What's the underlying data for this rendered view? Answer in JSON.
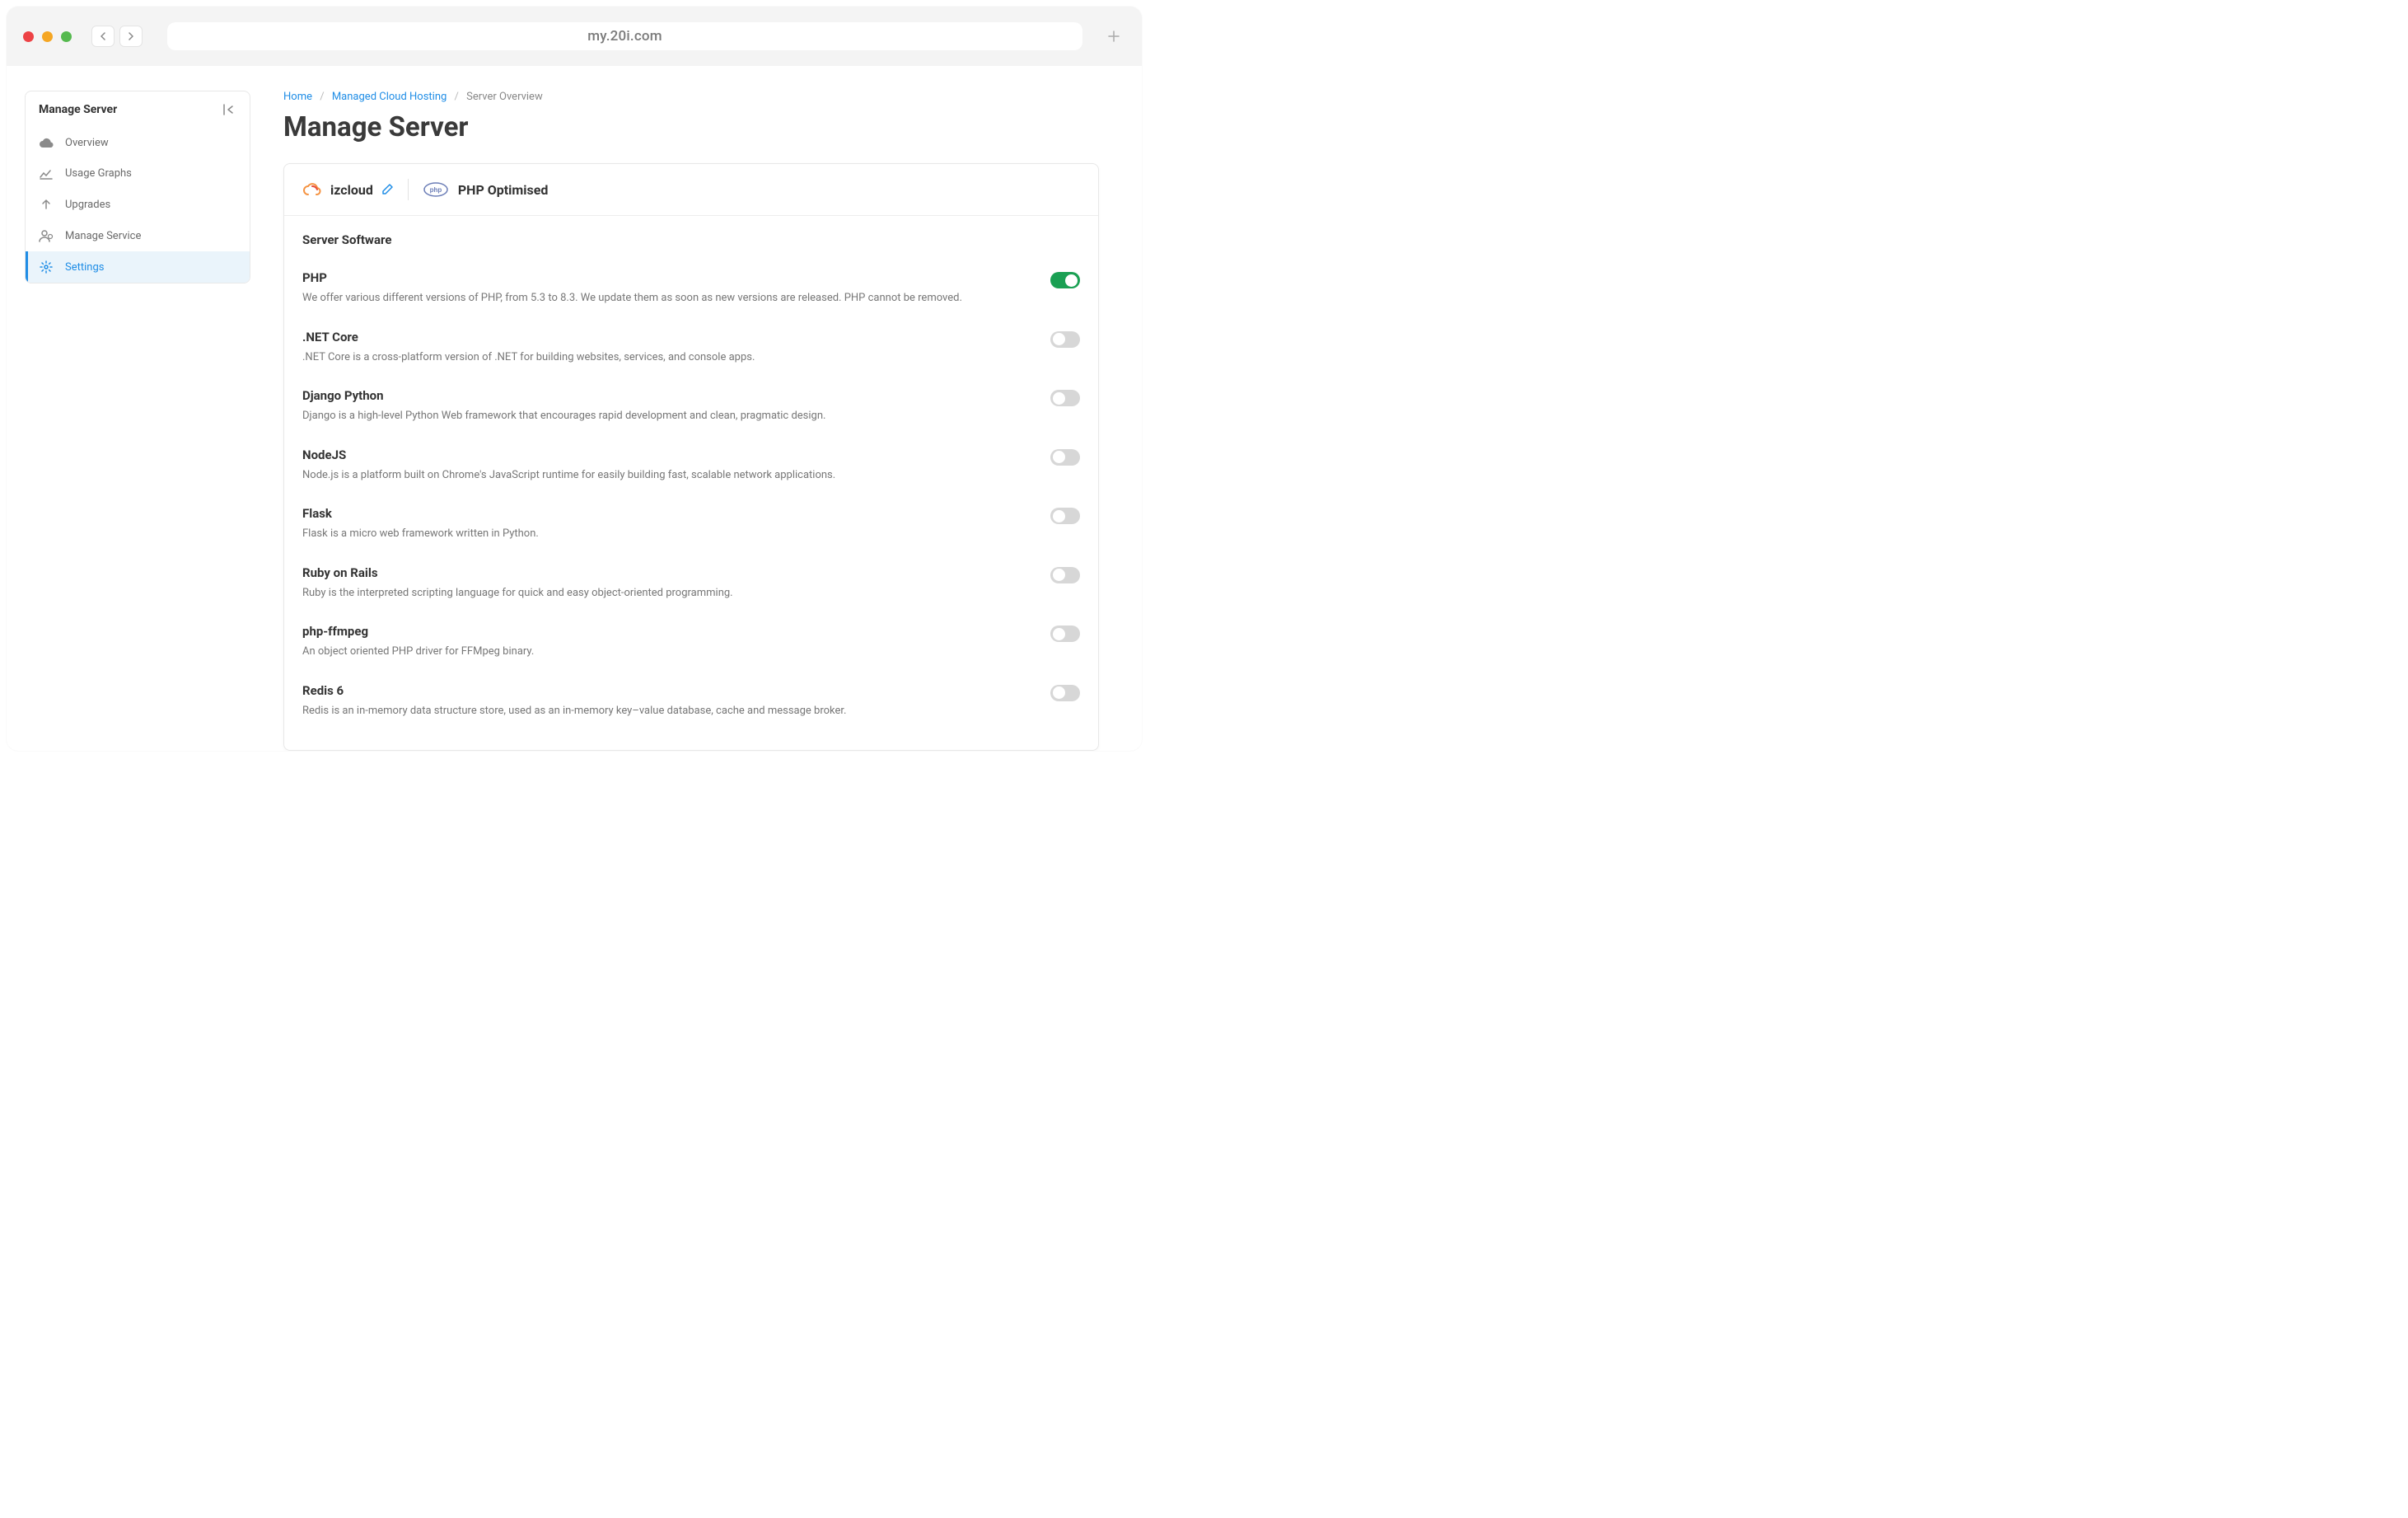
{
  "browser": {
    "url": "my.20i.com"
  },
  "sidebar": {
    "title": "Manage Server",
    "items": [
      {
        "label": "Overview",
        "icon": "cloud"
      },
      {
        "label": "Usage Graphs",
        "icon": "chart"
      },
      {
        "label": "Upgrades",
        "icon": "upload"
      },
      {
        "label": "Manage Service",
        "icon": "user-gear"
      },
      {
        "label": "Settings",
        "icon": "gear",
        "active": true
      }
    ]
  },
  "breadcrumb": {
    "items": [
      {
        "label": "Home",
        "link": true
      },
      {
        "label": "Managed Cloud Hosting",
        "link": true
      },
      {
        "label": "Server Overview",
        "link": false
      }
    ]
  },
  "page_title": "Manage Server",
  "server": {
    "name": "izcloud",
    "profile": "PHP Optimised"
  },
  "section_title": "Server Software",
  "software": [
    {
      "name": "PHP",
      "desc": "We offer various different versions of PHP, from 5.3 to 8.3. We update them as soon as new versions are released. PHP cannot be removed.",
      "enabled": true
    },
    {
      "name": ".NET Core",
      "desc": ".NET Core is a cross-platform version of .NET for building websites, services, and console apps.",
      "enabled": false
    },
    {
      "name": "Django Python",
      "desc": "Django is a high-level Python Web framework that encourages rapid development and clean, pragmatic design.",
      "enabled": false
    },
    {
      "name": "NodeJS",
      "desc": "Node.js is a platform built on Chrome's JavaScript runtime for easily building fast, scalable network applications.",
      "enabled": false
    },
    {
      "name": "Flask",
      "desc": "Flask is a micro web framework written in Python.",
      "enabled": false
    },
    {
      "name": "Ruby on Rails",
      "desc": "Ruby is the interpreted scripting language for quick and easy object-oriented programming.",
      "enabled": false
    },
    {
      "name": "php-ffmpeg",
      "desc": "An object oriented PHP driver for FFMpeg binary.",
      "enabled": false
    },
    {
      "name": "Redis 6",
      "desc": "Redis is an in-memory data structure store, used as an in-memory key–value database, cache and message broker.",
      "enabled": false
    }
  ]
}
